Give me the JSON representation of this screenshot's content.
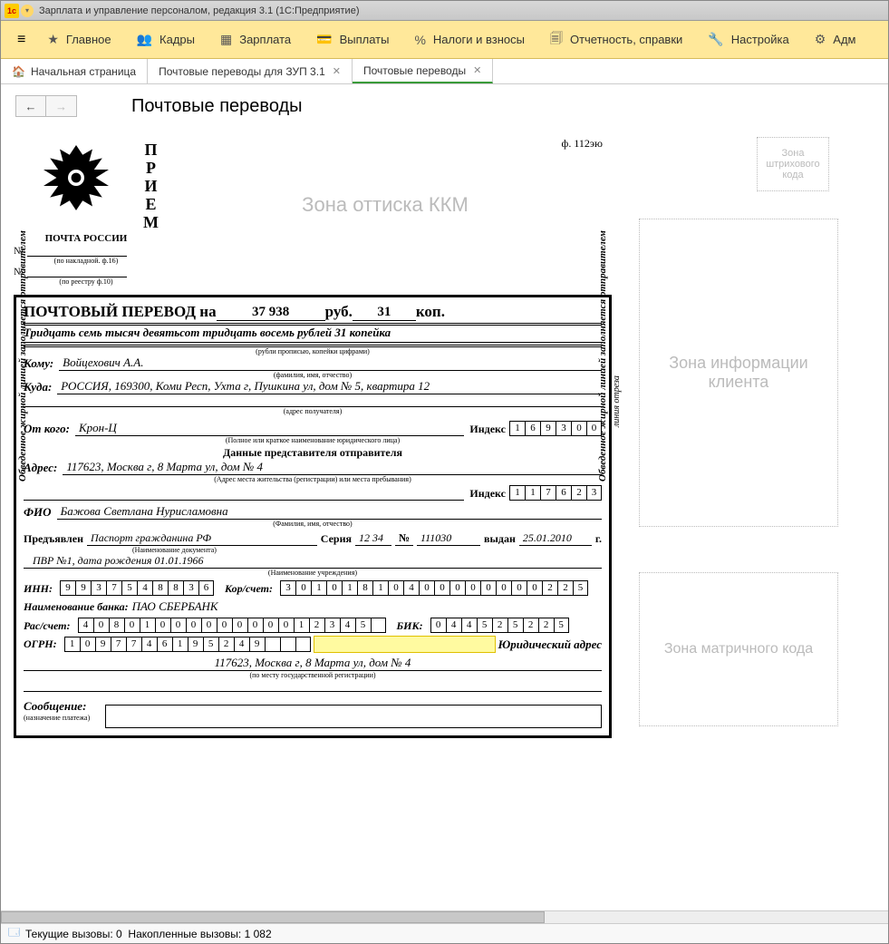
{
  "window": {
    "title": "Зарплата и управление персоналом, редакция 3.1  (1С:Предприятие)"
  },
  "menu": {
    "items": [
      {
        "icon": "★",
        "label": "Главное"
      },
      {
        "icon": "👥",
        "label": "Кадры"
      },
      {
        "icon": "▦",
        "label": "Зарплата"
      },
      {
        "icon": "💳",
        "label": "Выплаты"
      },
      {
        "icon": "%",
        "label": "Налоги и взносы"
      },
      {
        "icon": "🗐",
        "label": "Отчетность, справки"
      },
      {
        "icon": "🔧",
        "label": "Настройка"
      },
      {
        "icon": "⚙",
        "label": "Адм"
      }
    ]
  },
  "tabs": {
    "home": "Начальная страница",
    "t1": "Почтовые переводы для  ЗУП 3.1",
    "t2": "Почтовые переводы"
  },
  "page": {
    "title": "Почтовые переводы"
  },
  "header": {
    "priem": "П Р И Е М",
    "post_russia": "ПОЧТА РОССИИ",
    "no": "№",
    "waybill_cap": "(по накладной. ф.16)",
    "registry_cap": "(по реестру ф.10)",
    "form_no": "ф. 112эю",
    "kkm_zone": "Зона оттиска ККМ"
  },
  "form": {
    "title": "ПОЧТОВЫЙ ПЕРЕВОД на",
    "rub": "37 938",
    "rub_lbl": "руб.",
    "kop": "31",
    "kop_lbl": "коп.",
    "words": "Тридцать семь тысяч девятьсот тридцать восемь рублей 31 копейка",
    "words_cap": "(рубли прописью, копейки цифрами)",
    "to_lbl": "Кому:",
    "to": "Войцехович А.А.",
    "to_cap": "(фамилия, имя, отчество)",
    "where_lbl": "Куда:",
    "where": "РОССИЯ, 169300, Коми Респ, Ухта г, Пушкина ул, дом № 5, квартира 12",
    "where_cap": "(адрес получателя)",
    "from_lbl": "От кого:",
    "from": "Крон-Ц",
    "index_lbl": "Индекс",
    "index1": [
      "1",
      "6",
      "9",
      "3",
      "0",
      "0"
    ],
    "from_cap": "(Полное или краткое наименование юридического лица)",
    "rep_title": "Данные представителя отправителя",
    "addr_lbl": "Адрес:",
    "addr": "117623, Москва г, 8 Марта ул, дом № 4",
    "addr_cap": "(Адрес места жительства (регистрации) или места пребывания)",
    "index2": [
      "1",
      "1",
      "7",
      "6",
      "2",
      "3"
    ],
    "fio_lbl": "ФИО",
    "fio": "Бажова Светлана Нурисламовна",
    "fio_cap": "(Фамилия, имя, отчество)",
    "doc_lbl": "Предъявлен",
    "doc": "Паспорт гражданина РФ",
    "ser_lbl": "Серия",
    "ser": "12 34",
    "num_lbl": "№",
    "num": "111030",
    "issued_lbl": "выдан",
    "issued": "25.01.2010",
    "year": "г.",
    "doc_cap": "(Наименование документа)",
    "pvr": "ПВР №1,   дата рождения  01.01.1966",
    "inst_cap": "(Наименование учреждения)",
    "inn_lbl": "ИНН:",
    "inn": [
      "9",
      "9",
      "3",
      "7",
      "5",
      "4",
      "8",
      "8",
      "3",
      "6"
    ],
    "kor_lbl": "Кор/счет:",
    "kor": [
      "3",
      "0",
      "1",
      "0",
      "1",
      "8",
      "1",
      "0",
      "4",
      "0",
      "0",
      "0",
      "0",
      "0",
      "0",
      "0",
      "0",
      "2",
      "2",
      "5"
    ],
    "bank_lbl": "Наименование банка:",
    "bank": "ПАО СБЕРБАНК",
    "ras_lbl": "Рас/счет:",
    "ras": [
      "4",
      "0",
      "8",
      "0",
      "1",
      "0",
      "0",
      "0",
      "0",
      "0",
      "0",
      "0",
      "0",
      "0",
      "1",
      "2",
      "3",
      "4",
      "5",
      ""
    ],
    "bik_lbl": "БИК:",
    "bik": [
      "0",
      "4",
      "4",
      "5",
      "2",
      "5",
      "2",
      "2",
      "5"
    ],
    "ogrn_lbl": "ОГРН:",
    "ogrn": [
      "1",
      "0",
      "9",
      "7",
      "7",
      "4",
      "6",
      "1",
      "9",
      "5",
      "2",
      "4",
      "9",
      "",
      "",
      ""
    ],
    "legal_lbl": "Юридический адрес",
    "legal": "117623, Москва г, 8 Марта ул, дом № 4",
    "legal_cap": "(по месту государственной регистрации)",
    "msg_lbl": "Сообщение:",
    "msg_cap": "(назначение платежа)",
    "side_text": "Обведенное жирной линией заполняется отправителем",
    "side_cut": "линия отреза"
  },
  "zones": {
    "barcode": "Зона штрихового кода",
    "client": "Зона информации клиента",
    "matrix": "Зона матричного кода"
  },
  "status": {
    "current_lbl": "Текущие вызовы:",
    "current": "0",
    "acc_lbl": "Накопленные вызовы:",
    "acc": "1 082"
  }
}
